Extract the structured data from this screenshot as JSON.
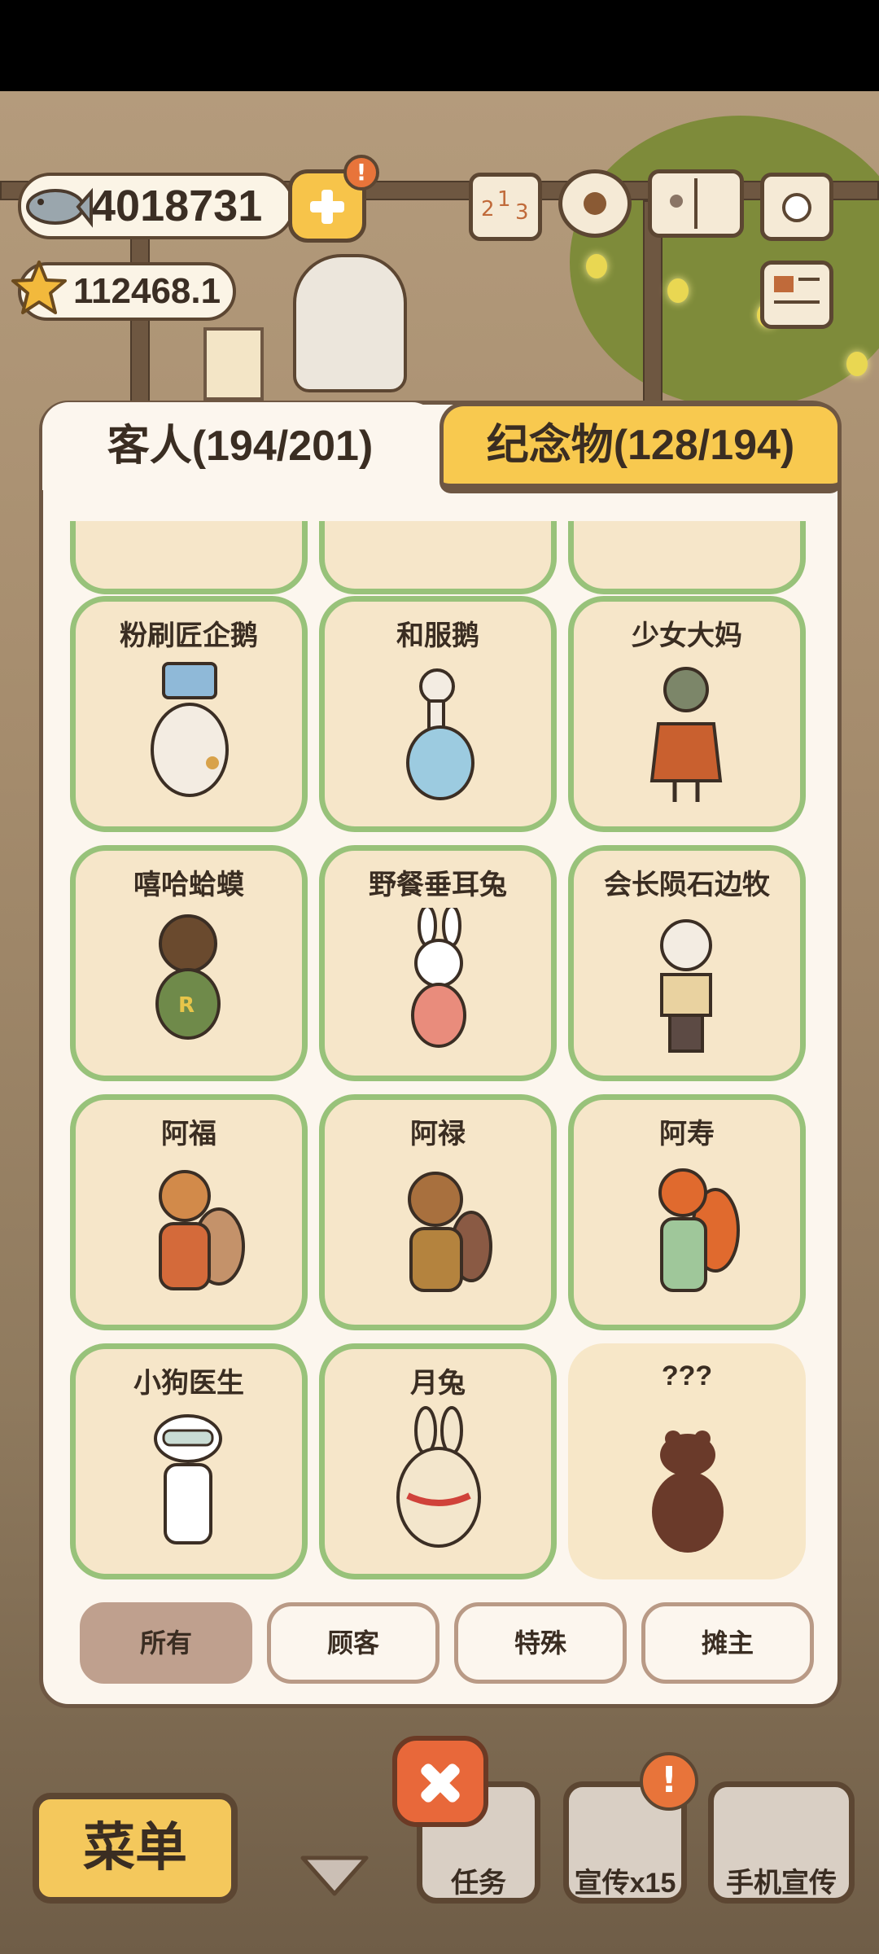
{
  "hud": {
    "fish_count": "4018731",
    "star_count": "112468.1",
    "plus_alert": "!"
  },
  "top_icons": [
    "leaderboard-icon",
    "settings-gear-icon",
    "paw-book-icon",
    "camera-icon",
    "newspaper-icon"
  ],
  "tabs": {
    "guests": "客人(194/201)",
    "souvenirs": "纪念物(128/194)"
  },
  "cards": [
    {
      "name": "粉刷匠企鹅",
      "icon": "penguin-painter"
    },
    {
      "name": "和服鹅",
      "icon": "kimono-goose"
    },
    {
      "name": "少女大妈",
      "icon": "lady-aunt"
    },
    {
      "name": "嘻哈蛤蟆",
      "icon": "hiphop-toad"
    },
    {
      "name": "野餐垂耳兔",
      "icon": "picnic-lop-rabbit"
    },
    {
      "name": "会长陨石边牧",
      "icon": "border-collie-president"
    },
    {
      "name": "阿福",
      "icon": "squirrel-fu"
    },
    {
      "name": "阿禄",
      "icon": "beaver-lu"
    },
    {
      "name": "阿寿",
      "icon": "red-squirrel-shou"
    },
    {
      "name": "小狗医生",
      "icon": "doctor-dog"
    },
    {
      "name": "月兔",
      "icon": "moon-rabbit"
    },
    {
      "name": "???",
      "icon": "locked-silhouette"
    }
  ],
  "filters": [
    "所有",
    "顾客",
    "特殊",
    "摊主"
  ],
  "bottom_bar": {
    "menu": "菜单",
    "tasks": "任务",
    "promo": "宣传x15",
    "phone_promo": "手机宣传",
    "promo_alert": "!"
  },
  "colors": {
    "card_border": "#98c27a",
    "tab_inactive": "#f8c94f",
    "close_button": "#e8683a",
    "filter_active": "#bfa08e"
  }
}
